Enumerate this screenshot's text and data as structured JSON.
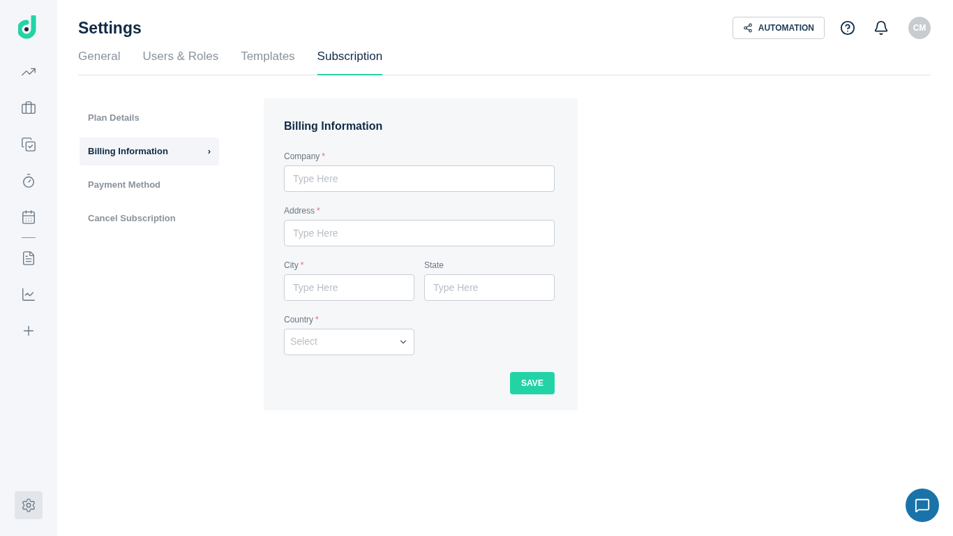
{
  "sidebar": {
    "settings": {
      "selected": true
    }
  },
  "header": {
    "title": "Settings",
    "automation_button": "AUTOMATION",
    "avatar": "CM"
  },
  "tabs": [
    {
      "label": "General",
      "selected": false
    },
    {
      "label": "Users & Roles",
      "selected": false
    },
    {
      "label": "Templates",
      "selected": false
    },
    {
      "label": "Subscription",
      "selected": true
    }
  ],
  "menu": [
    {
      "label": "Plan Details",
      "selected": false
    },
    {
      "label": "Billing Information",
      "selected": true,
      "chevron": "›"
    },
    {
      "label": "Payment Method",
      "selected": false
    },
    {
      "label": "Cancel Subscription",
      "selected": false
    }
  ],
  "form": {
    "title": "Billing Information",
    "rows": [
      [
        {
          "kind": "input",
          "label": "Company",
          "mark": "*",
          "placeholder": "Type Here"
        }
      ],
      [
        {
          "kind": "input",
          "label": "Address",
          "mark": "*",
          "placeholder": "Type Here"
        }
      ],
      [
        {
          "kind": "input",
          "label": "City",
          "mark": "*",
          "placeholder": "Type Here"
        },
        {
          "kind": "input",
          "label": "State",
          "placeholder": "Type Here"
        }
      ],
      [
        {
          "kind": "select",
          "label": "Country",
          "mark": "*",
          "placeholder": "Select"
        }
      ]
    ],
    "save": "SAVE"
  }
}
